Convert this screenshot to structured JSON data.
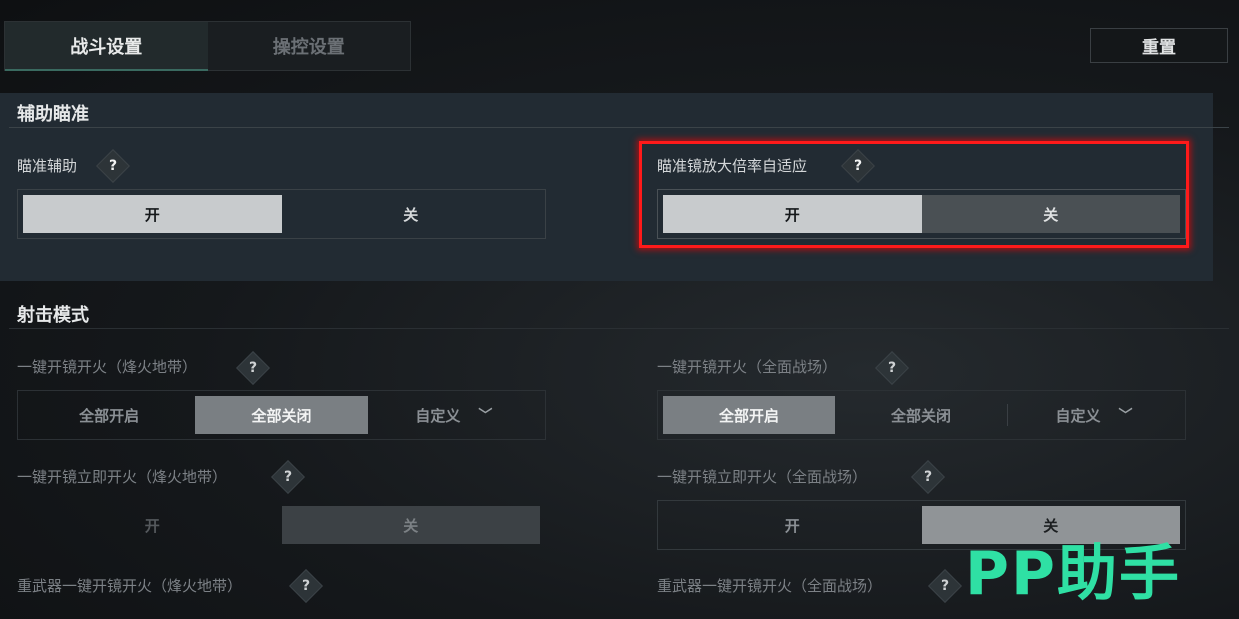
{
  "tabs": [
    {
      "label": "战斗设置",
      "active": true
    },
    {
      "label": "操控设置",
      "active": false
    }
  ],
  "reset_label": "重置",
  "aim_section": {
    "title": "辅助瞄准",
    "aim_assist": {
      "label": "瞄准辅助",
      "on": "开",
      "off": "关",
      "selected": "开"
    },
    "scope_adaptive": {
      "label": "瞄准镜放大倍率自适应",
      "on": "开",
      "off": "关",
      "selected": "开"
    }
  },
  "fire_section": {
    "title": "射击模式",
    "one_key_fire_beacon": {
      "label": "一键开镜开火（烽火地带）",
      "options": [
        "全部开启",
        "全部关闭",
        "自定义"
      ],
      "selected": "全部关闭"
    },
    "one_key_fire_battlefield": {
      "label": "一键开镜开火（全面战场）",
      "options": [
        "全部开启",
        "全部关闭",
        "自定义"
      ],
      "selected": "全部开启"
    },
    "instant_fire_beacon": {
      "label": "一键开镜立即开火（烽火地带）",
      "on": "开",
      "off": "关",
      "selected": "关"
    },
    "instant_fire_battlefield": {
      "label": "一键开镜立即开火（全面战场）",
      "on": "开",
      "off": "关",
      "selected": "关"
    },
    "heavy_beacon": {
      "label": "重武器一键开镜开火（烽火地带）"
    },
    "heavy_battlefield": {
      "label": "重武器一键开镜开火（全面战场）"
    }
  },
  "help_glyph": "?",
  "chevron_glyph": "﹀",
  "watermark": "PP助手",
  "colors": {
    "highlight": "#ff1a1a",
    "watermark": "#2fe0a4",
    "selected_toggle": "#c8cbcd"
  }
}
